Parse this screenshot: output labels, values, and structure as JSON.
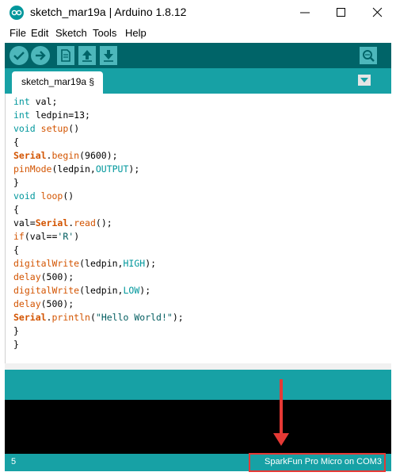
{
  "window": {
    "title": "sketch_mar19a | Arduino 1.8.12"
  },
  "menu": {
    "items": [
      "File",
      "Edit",
      "Sketch",
      "Tools",
      "Help"
    ]
  },
  "tabs": {
    "active": "sketch_mar19a §"
  },
  "editor": {
    "lines": [
      "int val;",
      "int ledpin=13;",
      "void setup()",
      "{",
      "Serial.begin(9600);",
      "pinMode(ledpin,OUTPUT);",
      "}",
      "void loop()",
      "{",
      "val=Serial.read();",
      "if(val=='R')",
      "{",
      "digitalWrite(ledpin,HIGH);",
      "delay(500);",
      "digitalWrite(ledpin,LOW);",
      "delay(500);",
      "Serial.println(\"Hello World!\");",
      "}",
      "}"
    ]
  },
  "status": {
    "line_number": "5",
    "board": "SparkFun Pro Micro on COM3"
  },
  "colors": {
    "toolbar": "#006468",
    "accent": "#17a1a5",
    "button": "#4db7bb",
    "annotation": "#e53935"
  },
  "icons": [
    "arduino-logo-icon",
    "minimize-icon",
    "maximize-icon",
    "close-icon",
    "verify-icon",
    "upload-icon",
    "new-icon",
    "open-icon",
    "save-icon",
    "serial-monitor-icon",
    "tab-menu-icon"
  ]
}
